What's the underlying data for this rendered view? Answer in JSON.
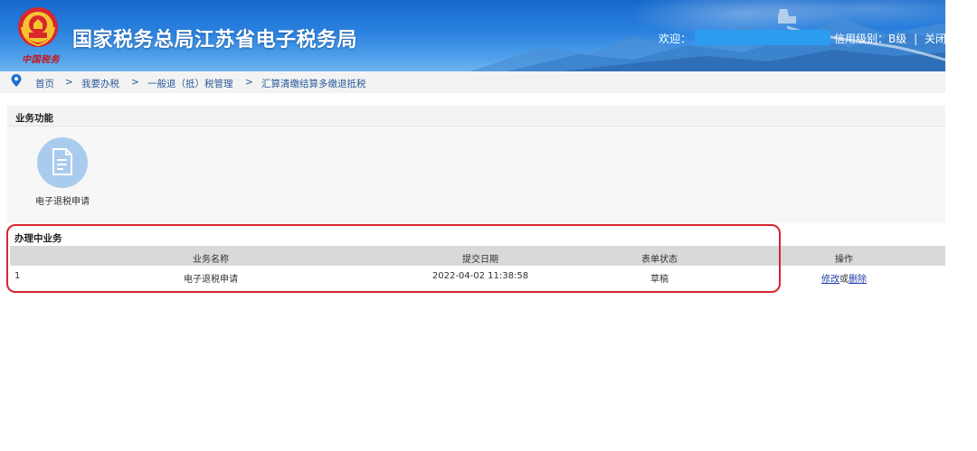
{
  "header": {
    "title": "国家税务总局江苏省电子税务局",
    "slogan": "中国税务",
    "welcome_label": "欢迎：",
    "credit_level": "信用级别：B级",
    "separator": "|",
    "close_label": "关闭"
  },
  "breadcrumb": {
    "items": [
      "首页",
      "我要办税",
      "一般退（抵）税管理",
      "汇算清缴结算多缴退抵税"
    ],
    "separator": ">"
  },
  "business_functions": {
    "title": "业务功能",
    "items": [
      {
        "label": "电子退税申请",
        "icon": "document-icon"
      }
    ]
  },
  "pending_business": {
    "title": "办理中业务",
    "columns": [
      "业务名称",
      "提交日期",
      "表单状态",
      "操作"
    ],
    "rows": [
      {
        "index": "1",
        "name": "电子退税申请",
        "date": "2022-04-02 11:38:58",
        "status": "草稿",
        "edit_label": "修改",
        "or_label": "或",
        "delete_label": "删除"
      }
    ]
  },
  "colors": {
    "header_blue": "#2b82df",
    "link": "#1f3fa8",
    "highlight_red": "#d3262e",
    "icon_circle": "#a9cbee"
  }
}
